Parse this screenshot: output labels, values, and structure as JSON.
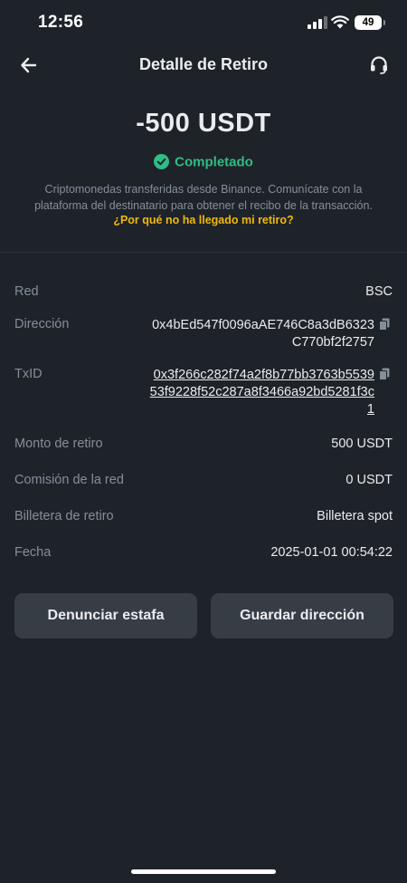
{
  "status_bar": {
    "time": "12:56",
    "battery": "49"
  },
  "nav": {
    "title": "Detalle de Retiro",
    "back_icon": "back-arrow-icon",
    "support_icon": "headset-icon"
  },
  "summary": {
    "amount": "-500 USDT",
    "status": "Completado",
    "status_color": "#2ebd85",
    "note": "Criptomonedas transferidas desde Binance. Comunícate con la plataforma del destinatario para obtener el recibo de la transacción.",
    "help_link": "¿Por qué no ha llegado mi retiro?",
    "link_color": "#f0b90b"
  },
  "details": {
    "network": {
      "label": "Red",
      "value": "BSC"
    },
    "address": {
      "label": "Dirección",
      "value": "0x4bEd547f0096aAE746C8a3dB6323C770bf2f2757"
    },
    "txid": {
      "label": "TxID",
      "value": "0x3f266c282f74a2f8b77bb3763b553953f9228f52c287a8f3466a92bd5281f3c1"
    },
    "amount": {
      "label": "Monto de retiro",
      "value": "500 USDT"
    },
    "fee": {
      "label": "Comisión de la red",
      "value": "0 USDT"
    },
    "wallet": {
      "label": "Billetera de retiro",
      "value": "Billetera spot"
    },
    "date": {
      "label": "Fecha",
      "value": "2025-01-01 00:54:22"
    }
  },
  "actions": {
    "report": "Denunciar estafa",
    "save": "Guardar dirección"
  }
}
